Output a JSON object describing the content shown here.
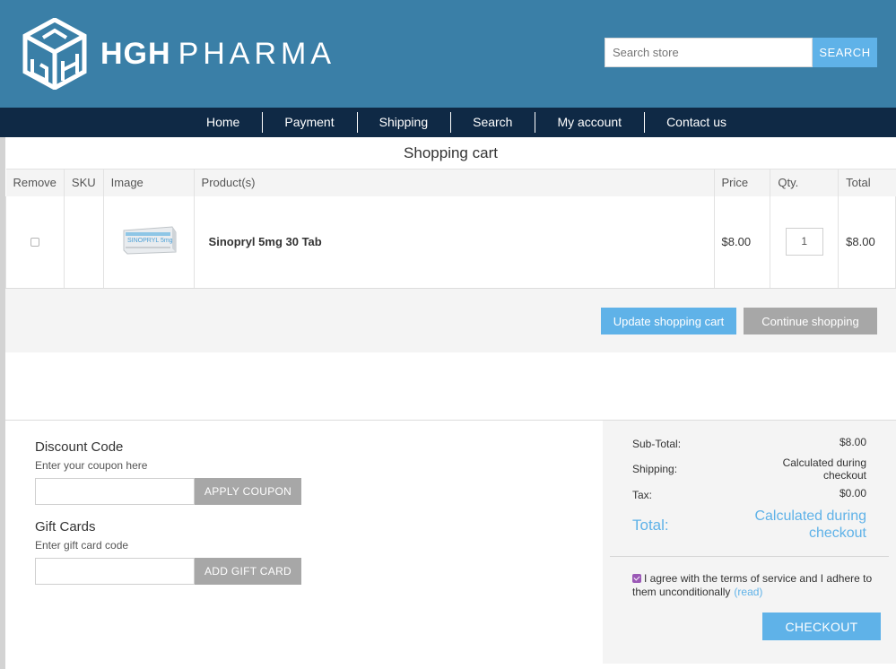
{
  "header": {
    "brand_bold": "HGH",
    "brand_light": "PHARMA",
    "search_placeholder": "Search store",
    "search_button": "SEARCH",
    "header_color": "#3a7fa7"
  },
  "nav": {
    "items": [
      "Home",
      "Payment",
      "Shipping",
      "Search",
      "My account",
      "Contact us"
    ]
  },
  "cart": {
    "title": "Shopping cart",
    "columns": [
      "Remove",
      "SKU",
      "Image",
      "Product(s)",
      "Price",
      "Qty.",
      "Total"
    ],
    "rows": [
      {
        "remove_checked": false,
        "sku": "",
        "image_text": "SINOPRYL 5mg",
        "product": "Sinopryl 5mg 30 Tab",
        "price": "$8.00",
        "qty": "1",
        "total": "$8.00"
      }
    ],
    "update_button": "Update shopping cart",
    "continue_button": "Continue shopping"
  },
  "discount": {
    "title": "Discount Code",
    "hint": "Enter your coupon here",
    "button": "APPLY COUPON"
  },
  "gift": {
    "title": "Gift Cards",
    "hint": "Enter gift card code",
    "button": "ADD GIFT CARD"
  },
  "totals": {
    "subtotal_label": "Sub-Total:",
    "subtotal_value": "$8.00",
    "shipping_label": "Shipping:",
    "shipping_value_l1": "Calculated during",
    "shipping_value_l2": "checkout",
    "tax_label": "Tax:",
    "tax_value": "$0.00",
    "total_label": "Total:",
    "total_value_l1": "Calculated during",
    "total_value_l2": "checkout",
    "terms_text": "I agree with the terms of service and I adhere to them unconditionally",
    "terms_checked": true,
    "read_link": "(read)",
    "checkout_button": "CHECKOUT"
  },
  "colors": {
    "accent": "#5fb2e8",
    "nav_bg": "#0f2945",
    "grey_button": "#a7a7a7",
    "checkbox": "#9b59b6"
  }
}
